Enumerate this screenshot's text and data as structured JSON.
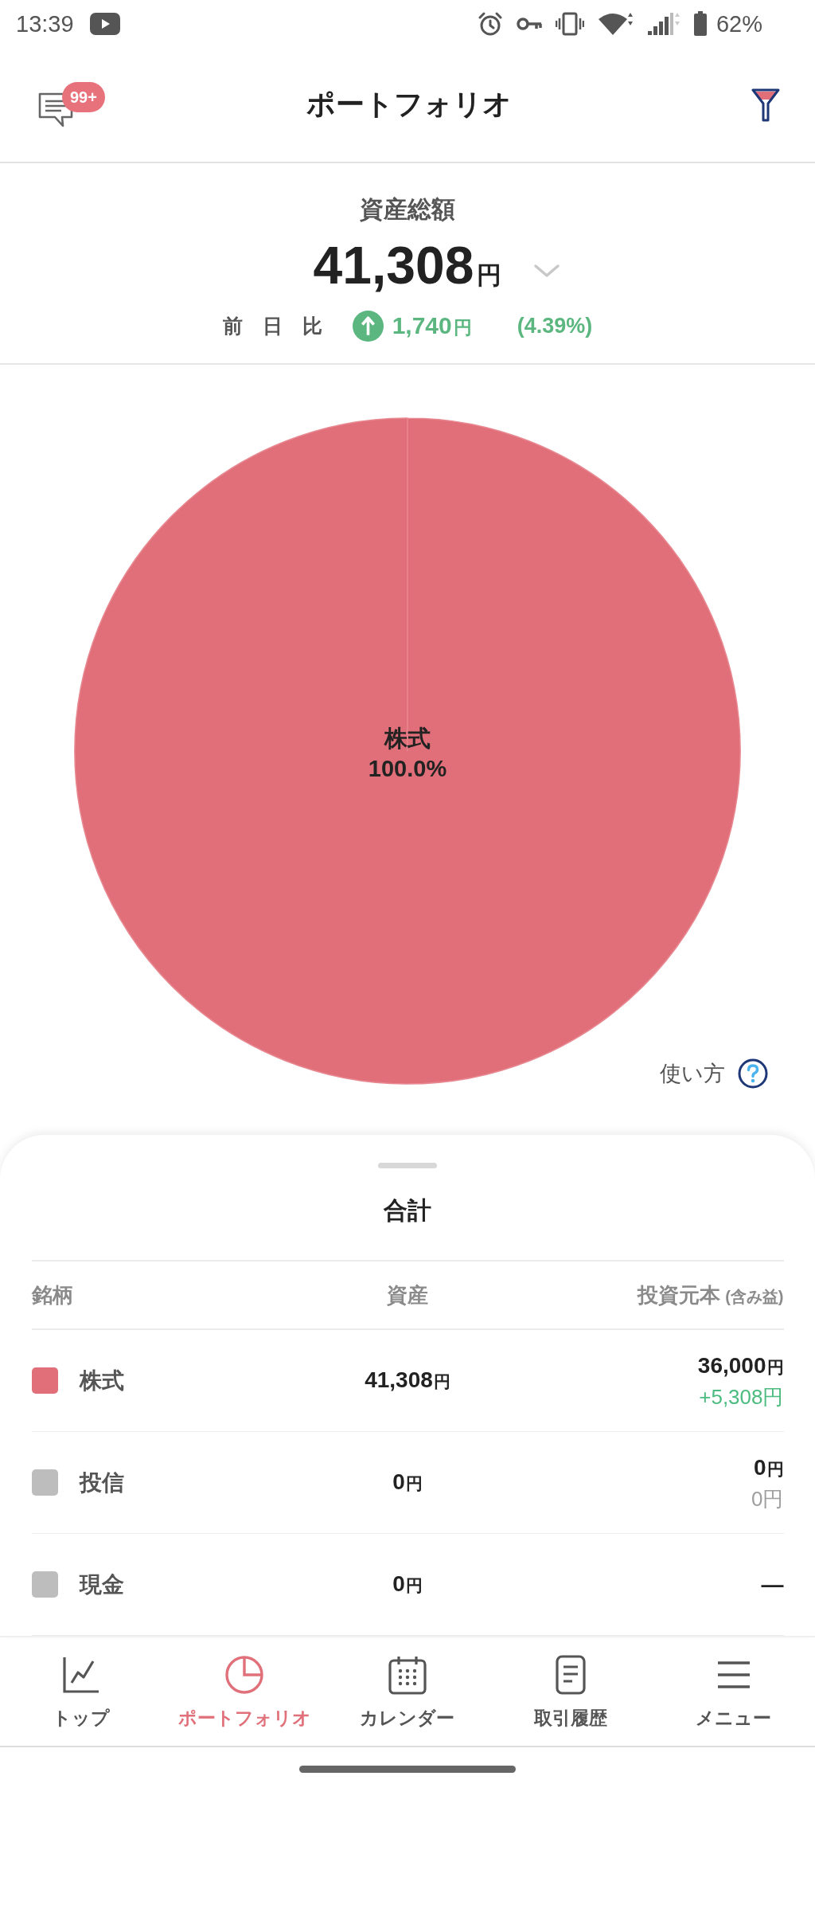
{
  "status_bar": {
    "time": "13:39",
    "battery": "62%"
  },
  "header": {
    "title": "ポートフォリオ",
    "badge": "99+"
  },
  "summary": {
    "label": "資産総額",
    "amount": "41,308",
    "unit": "円",
    "change": {
      "label": "前 日 比",
      "rising": true,
      "amount": "1,740",
      "unit": "円",
      "percent": "(4.39%)"
    }
  },
  "chart": {
    "chart_data": {
      "type": "pie",
      "categories": [
        "株式"
      ],
      "values": [
        100.0
      ],
      "value_labels": [
        "100.0%"
      ]
    },
    "help_link": "使い方"
  },
  "holdings": {
    "title": "合計",
    "columns": [
      {
        "label": "銘柄"
      },
      {
        "label": "資産"
      },
      {
        "label": "投資元本",
        "note": "(含み益)"
      }
    ],
    "rows": [
      {
        "name": "株式",
        "color": "#e06f79",
        "asset": "41,308",
        "asset_unit": "円",
        "principal": "36,000",
        "principal_unit": "円",
        "gain": "+5,308円",
        "gain_positive": true
      },
      {
        "name": "投信",
        "color": "#bdbdbd",
        "asset": "0",
        "asset_unit": "円",
        "principal": "0",
        "principal_unit": "円",
        "gain": "0円",
        "gain_positive": false
      },
      {
        "name": "現金",
        "color": "#bdbdbd",
        "asset": "0",
        "asset_unit": "円",
        "principal": "—"
      }
    ]
  },
  "bottom_nav": {
    "items": [
      {
        "label": "トップ",
        "selected": false
      },
      {
        "label": "ポートフォリオ",
        "selected": true
      },
      {
        "label": "カレンダー",
        "selected": false
      },
      {
        "label": "取引履歴",
        "selected": false
      },
      {
        "label": "メニュー",
        "selected": false
      }
    ]
  }
}
